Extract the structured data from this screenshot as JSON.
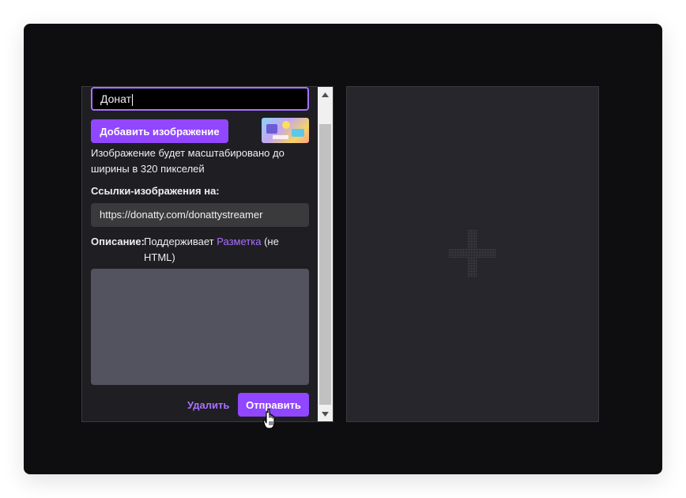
{
  "editor": {
    "title_value": "Донат",
    "add_image_label": "Добавить изображение",
    "scale_hint": "Изображение будет масштабировано до ширины в 320 пикселей",
    "links_label": "Ссылки-изображения на:",
    "link_url": "https://donatty.com/donattystreamer",
    "description_label": "Описание:",
    "description_hint_prefix": "Поддерживает",
    "description_hint_link": "Разметка",
    "description_hint_suffix": "(не HTML)",
    "description_value": "",
    "delete_label": "Удалить",
    "send_label": "Отправить"
  },
  "icons": {
    "scroll_up": "scroll-up-arrow-icon",
    "scroll_down": "scroll-down-arrow-icon",
    "add": "plus-icon",
    "cursor": "hand-pointer-icon"
  },
  "colors": {
    "accent": "#9147ff",
    "accent_text": "#a970ff",
    "panel_bg": "#1f1f23",
    "stage_bg": "#0e0e10",
    "field_bg": "#3a3a3d",
    "textarea_bg": "#53535f"
  }
}
